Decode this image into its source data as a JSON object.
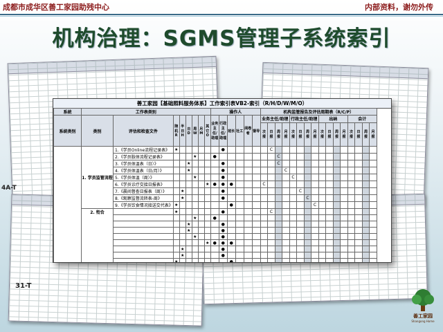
{
  "header": {
    "left": "成都市成华区善工家园助残中心",
    "right": "内部资料，谢勿外传"
  },
  "title": "机构治理：SGMS管理子系统索引",
  "main_sheet": {
    "caption": "善工家园【基础照料服务体系】工作索引表VB2-索引（R/H/D/W/M/O）",
    "col_group": {
      "system": "系统",
      "work_type": "工作表类别",
      "operator": "操作人",
      "supervision": "机构监管报告及评估周期表（R/C/P）"
    },
    "headers": {
      "system_type": "系统类别",
      "category": "类别",
      "doc": "评估和检查文件",
      "freq": [
        "随机R",
        "半日H",
        "日D",
        "周W",
        "月M",
        "其它O"
      ],
      "ops": [
        "业务主任/助理",
        "行政主任/助理",
        "班长",
        "社工",
        "阅卷者",
        "督导"
      ],
      "report_groups": [
        "业务主任/助理",
        "行政主任/助理",
        "出纳",
        "会计"
      ],
      "report_subcols": [
        "次报",
        "日报",
        "周报",
        "月报"
      ]
    },
    "category_name": "1. 学员监管流程",
    "category_name2": "2. 衔合",
    "docs": [
      "1.《学员Online流程记录表》",
      "2.《学员肢体流程记录表》",
      "3.《学员体温表（日）》",
      "4.《学员体温表（日/月）》",
      "5.《学员体温（周）》",
      "6.《学员诊疗交接日报表》",
      "7.《晨间督查日报表（周）》",
      "8.《观察监督流转表-周》",
      "9.《学员饮食情况接送交代表》"
    ],
    "star": "★",
    "dot": "●",
    "mark_c": "C"
  },
  "side_labels": {
    "upper": "4A-T",
    "lower": "31-T"
  },
  "logo": {
    "text": "善工家园",
    "sub": "Shangong Home"
  }
}
